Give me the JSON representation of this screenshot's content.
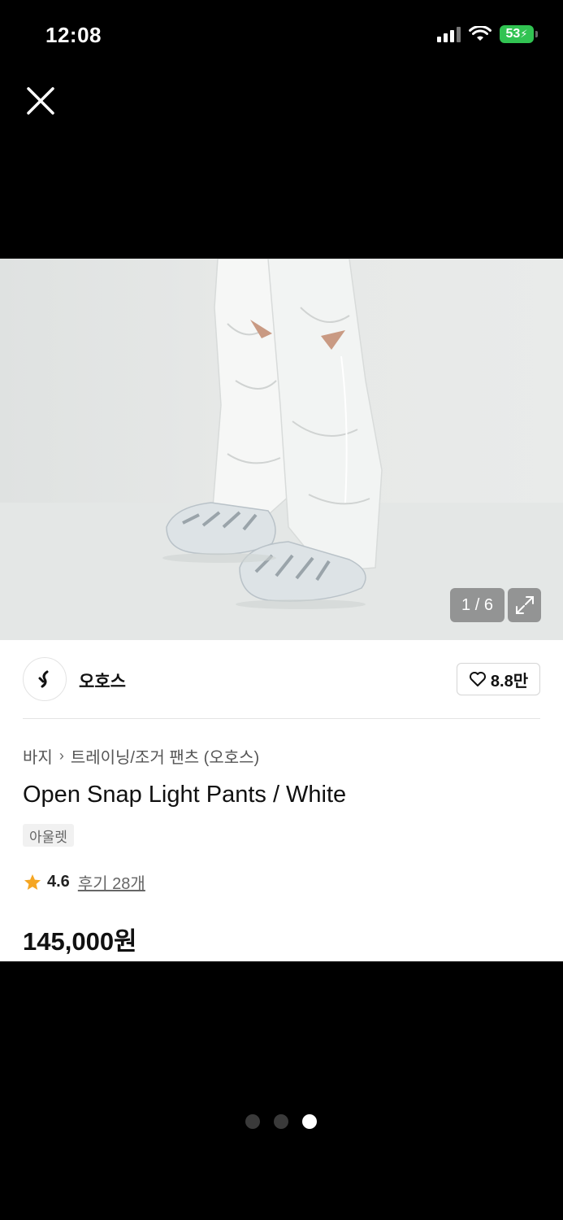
{
  "status_bar": {
    "time": "12:08",
    "battery": "53"
  },
  "gallery": {
    "counter": "1 / 6",
    "total_pages": 3,
    "active_page": 3
  },
  "brand": {
    "name": "오호스"
  },
  "likes": {
    "count": "8.8만"
  },
  "breadcrumb": {
    "category": "바지",
    "subcategory": "트레이닝/조거 팬츠 (오호스)"
  },
  "product": {
    "title": "Open Snap Light Pants / White",
    "tag": "아울렛",
    "rating": "4.6",
    "reviews": "후기 28개",
    "price": "145,000원"
  },
  "colors": {
    "star": "#f5a623",
    "battery": "#31c352"
  }
}
